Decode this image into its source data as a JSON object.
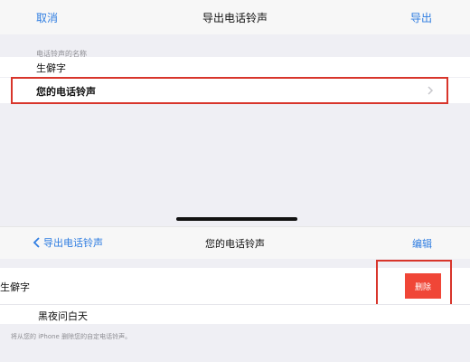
{
  "export_screen": {
    "nav": {
      "cancel": "取消",
      "title": "导出电话铃声",
      "export": "导出"
    },
    "section_label": "电话铃声的名称",
    "name_value": "生僻字",
    "ringtone_row_label": "您的电话铃声"
  },
  "ringtones_screen": {
    "nav": {
      "back": "导出电话铃声",
      "title": "您的电话铃声",
      "edit": "编辑"
    },
    "rows": [
      {
        "name": "生僻字"
      },
      {
        "name": "黑夜问白天"
      }
    ],
    "delete_label": "删除",
    "footnote": "将从您的 iPhone 删除您的自定电话铃声。"
  },
  "colors": {
    "accent": "#2f7de1",
    "highlight": "#d8352b",
    "delete": "#f04637",
    "background": "#efeff4"
  },
  "icons": {
    "row_chevron": "chevron-right-icon",
    "back_chevron": "chevron-left-icon"
  }
}
